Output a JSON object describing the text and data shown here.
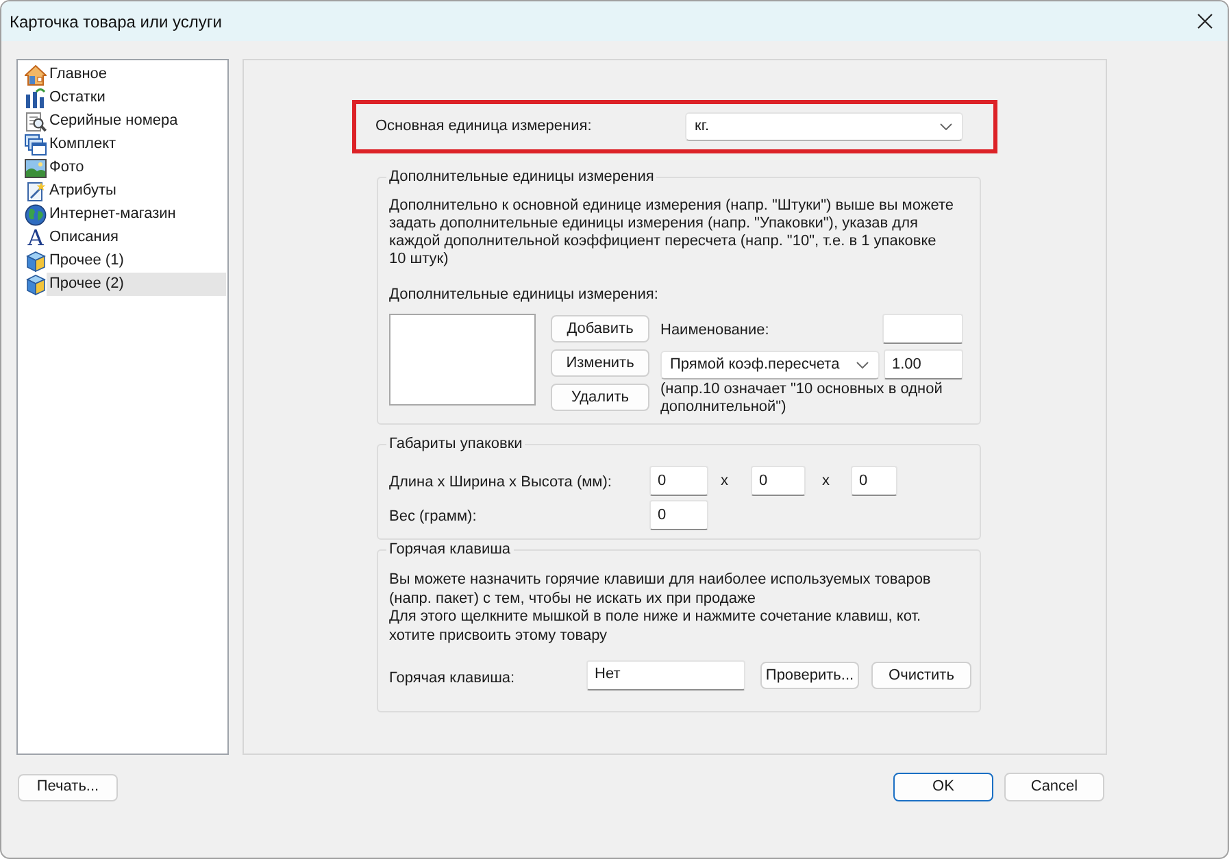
{
  "window": {
    "title": "Карточка товара или услуги"
  },
  "sidebar": {
    "items": [
      {
        "label": "Главное",
        "selected": false
      },
      {
        "label": "Остатки",
        "selected": false
      },
      {
        "label": "Серийные номера",
        "selected": false
      },
      {
        "label": "Комплект",
        "selected": false
      },
      {
        "label": "Фото",
        "selected": false
      },
      {
        "label": "Атрибуты",
        "selected": false
      },
      {
        "label": "Интернет-магазин",
        "selected": false
      },
      {
        "label": "Описания",
        "selected": false,
        "glyph": "A"
      },
      {
        "label": "Прочее (1)",
        "selected": false
      },
      {
        "label": "Прочее (2)",
        "selected": true
      }
    ]
  },
  "main_unit": {
    "label": "Основная единица измерения:",
    "value": "кг.",
    "highlighted": true
  },
  "extra_units": {
    "legend": "Дополнительные единицы измерения",
    "description": "Дополнительно к основной единице измерения (напр. \"Штуки\") выше вы можете задать дополнительные единицы измерения (напр. \"Упаковки\"), указав для каждой дополнительной коэффициент пересчета (напр. \"10\", т.е. в 1 упаковке 10 штук)",
    "list_label": "Дополнительные единицы измерения:",
    "buttons": [
      "Добавить",
      "Изменить",
      "Удалить"
    ],
    "name_label": "Наименование:",
    "ratio_mode": "Прямой коэф.пересчета",
    "ratio_value": "1.00",
    "note": "(напр.10 означает \"10 основных в одной дополнительной\")"
  },
  "package": {
    "legend": "Габариты упаковки",
    "dims_label": "Длина х Ширина х Высота (мм):",
    "dims": [
      "0",
      "0",
      "0"
    ],
    "separators": [
      "x",
      "x"
    ],
    "weight_label": "Вес (грамм):",
    "weight": "0"
  },
  "hotkey": {
    "legend": "Горячая клавиша",
    "paragraphs": [
      "Вы можете назначить горячие клавиши для наиболее используемых товаров (напр. пакет) с тем, чтобы не искать их при продаже",
      "Для этого щелкните мышкой в поле ниже и нажмите сочетание клавиш, кот. хотите присвоить этому товару"
    ],
    "label": "Горячая клавиша:",
    "value": "Нет",
    "buttons": [
      "Проверить...",
      "Очистить"
    ]
  },
  "footer": {
    "print_button": "Печать...",
    "buttons": [
      {
        "label": "OK",
        "default": true
      },
      {
        "label": "Cancel",
        "default": false
      }
    ]
  }
}
